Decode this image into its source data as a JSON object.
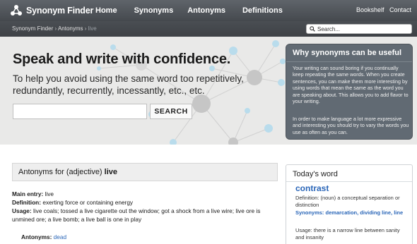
{
  "header": {
    "logo_text": "Synonym Finder",
    "nav": [
      "Home",
      "Synonyms",
      "Antonyms",
      "Definitions"
    ],
    "right_links": [
      "Bookshelf",
      "Contact"
    ],
    "bg_color": "#4f5459"
  },
  "subbar": {
    "breadcrumb": [
      "Synonym Finder",
      "Antonyms",
      "live"
    ],
    "breadcrumb_sep": "›",
    "search_placeholder": "Search..."
  },
  "hero": {
    "title": "Speak and write with confidence.",
    "text": "To help you avoid using the same word too repetitively, redundantly, recurrently, incessantly, etc., etc.",
    "search_value": "",
    "search_button": "SEARCH"
  },
  "why_box": {
    "title": "Why synonyms can be useful",
    "paragraph1": "Your writing can sound boring if you continually keep repeating the same words. When you create sentences, you can make them more interesting by using words that mean the same as the word you are speaking about. This allows you to add flavor to your writing.",
    "paragraph2": "In order to make language a lot more expressive and interesting you should try to vary the words you use as often as you can."
  },
  "antonyms": {
    "heading_prefix": "Antonyms for (adjective)",
    "heading_word": "live",
    "main_entry_label": "Main entry:",
    "main_entry_value": "live",
    "definition_label": "Definition:",
    "definition_value": "exerting force or containing energy",
    "usage_label": "Usage:",
    "usage_value": "live coals; tossed a live cigarette out the window; got a shock from a live wire; live ore is unmined ore; a live bomb; a live ball is one in play",
    "antonyms_label": "Antonyms:",
    "antonyms_value": "dead"
  },
  "today": {
    "title": "Today's word",
    "word": "contrast",
    "definition_label": "Definition:",
    "definition_value": "(noun) a conceptual separation or distinction",
    "synonyms_label": "Synonyms:",
    "synonyms_value": "demarcation, dividing line, line",
    "usage_label": "Usage:",
    "usage_value": "there is a narrow line between sanity and insanity"
  },
  "colors": {
    "accent_link": "#2a66b8",
    "hero_bg": "#e9e9e8",
    "why_box_bg": "#616a73",
    "node_blue": "#a9d3e6",
    "node_gray": "#c8c8c8"
  }
}
